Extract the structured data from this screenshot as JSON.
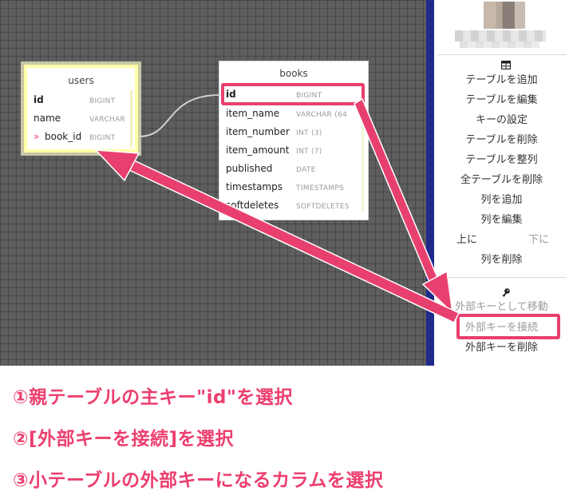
{
  "canvas": {
    "users_table": {
      "title": "users",
      "rows": [
        {
          "marker": "",
          "name": "id",
          "type": "BIGINT"
        },
        {
          "marker": "",
          "name": "name",
          "type": "VARCHAR"
        },
        {
          "marker": "»",
          "name": "book_id",
          "type": "BIGINT"
        }
      ]
    },
    "books_table": {
      "title": "books",
      "rows": [
        {
          "name": "id",
          "type": "BIGINT"
        },
        {
          "name": "item_name",
          "type": "VARCHAR (64"
        },
        {
          "name": "item_number",
          "type": "INT (3)"
        },
        {
          "name": "item_amount",
          "type": "INT (7)"
        },
        {
          "name": "published",
          "type": "DATE"
        },
        {
          "name": "timestamps",
          "type": "TIMESTAMPS"
        },
        {
          "name": "softdeletes",
          "type": "SOFTDELETES"
        }
      ]
    }
  },
  "sidebar": {
    "table_icon": "table-icon",
    "key_icon": "key-icon",
    "table_menu": [
      "テーブルを追加",
      "テーブルを編集",
      "キーの設定",
      "テーブルを削除",
      "テーブルを整列",
      "全テーブルを削除",
      "列を追加",
      "列を編集"
    ],
    "move_up": "上に",
    "move_down": "下に",
    "delete_column": "列を削除",
    "fk_menu": [
      "外部キーとして移動",
      "外部キーを接続",
      "外部キーを削除"
    ]
  },
  "annotations": {
    "step1": "①親テーブルの主キー\"id\"を選択",
    "step2": "②[外部キーを接続]を選択",
    "step3": "③小テーブルの外部キーになるカラムを選択"
  },
  "colors": {
    "highlight": "#e8406e",
    "canvas_bg": "#5e5e5e",
    "divider": "#1f2a8a"
  }
}
